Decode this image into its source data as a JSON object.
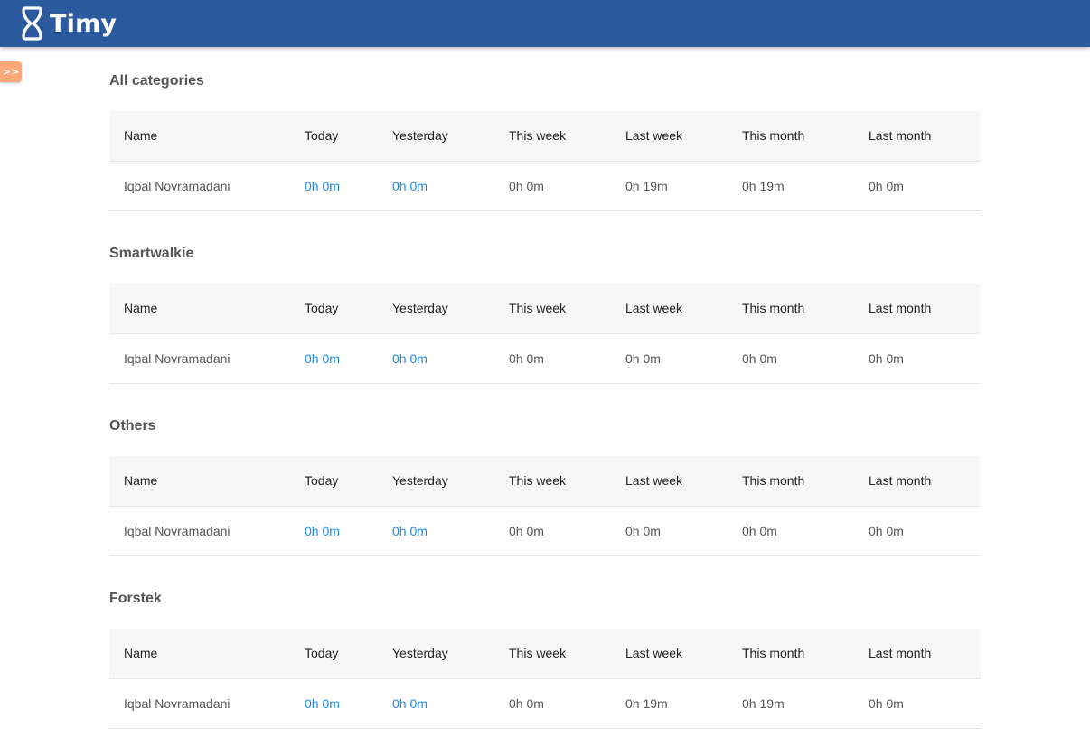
{
  "app": {
    "name": "Timy",
    "toggle_label": ">>",
    "colors": {
      "navbar": "#2b5b9e",
      "toggle": "#ffa877",
      "link": "#1e88e5"
    }
  },
  "columns": [
    "Name",
    "Today",
    "Yesterday",
    "This week",
    "Last week",
    "This month",
    "Last month"
  ],
  "sections": [
    {
      "title": "All categories",
      "row": {
        "name": "Iqbal Novramadani",
        "today": "0h 0m",
        "yesterday": "0h 0m",
        "this_week": "0h 0m",
        "last_week": "0h 19m",
        "this_month": "0h 19m",
        "last_month": "0h 0m"
      }
    },
    {
      "title": "Smartwalkie",
      "row": {
        "name": "Iqbal Novramadani",
        "today": "0h 0m",
        "yesterday": "0h 0m",
        "this_week": "0h 0m",
        "last_week": "0h 0m",
        "this_month": "0h 0m",
        "last_month": "0h 0m"
      }
    },
    {
      "title": "Others",
      "row": {
        "name": "Iqbal Novramadani",
        "today": "0h 0m",
        "yesterday": "0h 0m",
        "this_week": "0h 0m",
        "last_week": "0h 0m",
        "this_month": "0h 0m",
        "last_month": "0h 0m"
      }
    },
    {
      "title": "Forstek",
      "row": {
        "name": "Iqbal Novramadani",
        "today": "0h 0m",
        "yesterday": "0h 0m",
        "this_week": "0h 0m",
        "last_week": "0h 19m",
        "this_month": "0h 19m",
        "last_month": "0h 0m"
      }
    }
  ]
}
